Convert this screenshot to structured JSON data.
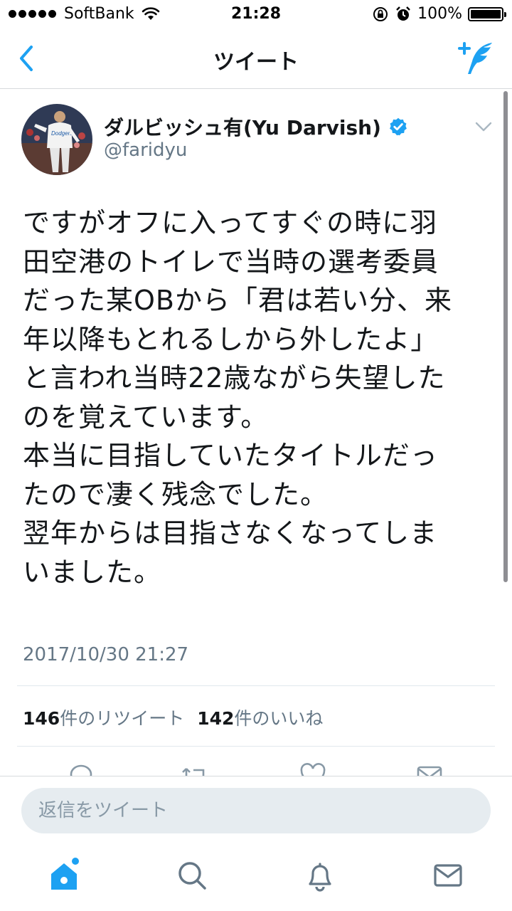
{
  "status_bar": {
    "carrier": "SoftBank",
    "time": "21:28",
    "battery": "100%"
  },
  "nav": {
    "title": "ツイート",
    "back_icon": "chevron-left-icon",
    "compose_icon": "compose-tweet-icon"
  },
  "tweet": {
    "author_name": "ダルビッシュ有(Yu Darvish)",
    "handle": "@faridyu",
    "text": "ですがオフに入ってすぐの時に羽\n田空港のトイレで当時の選考委員\nだった某OBから「君は若い分、来\n年以降もとれるしから外したよ」\nと言われ当時22歳ながら失望した\nのを覚えています。\n本当に目指していたタイトルだっ\nたので凄く残念でした。\n翌年からは目指さなくなってしま\nいました。",
    "timestamp": "2017/10/30 21:27",
    "retweet_count": "146",
    "retweet_label": "件のリツイート",
    "like_count": "142",
    "like_label": "件のいいね"
  },
  "reply": {
    "placeholder": "返信をツイート"
  },
  "colors": {
    "accent": "#1da1f2",
    "secondary_text": "#657786",
    "divider": "#e1e8ed"
  },
  "tabs": [
    "home-icon",
    "search-icon",
    "notifications-icon",
    "messages-icon"
  ]
}
